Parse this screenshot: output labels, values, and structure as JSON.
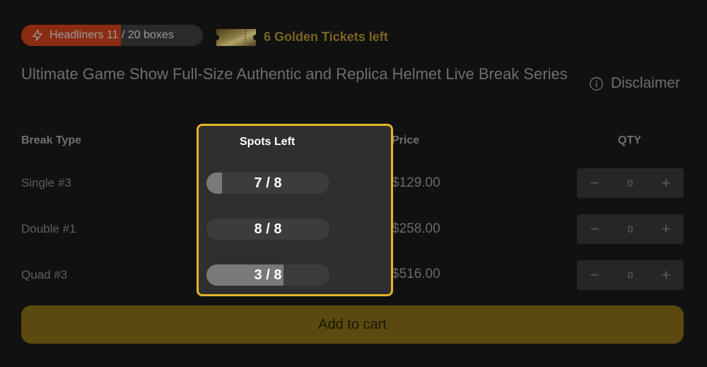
{
  "header": {
    "headliners_label": "Headliners 11 / 20 boxes",
    "headliners_progress": 0.55,
    "golden_tickets_label": "6 Golden Tickets left"
  },
  "title": "Ultimate Game Show Full-Size Authentic and Replica Helmet Live Break Series",
  "disclaimer_label": "Disclaimer",
  "table": {
    "columns": {
      "break_type": "Break Type",
      "spots_left": "Spots Left",
      "price": "Price",
      "qty": "QTY"
    },
    "rows": [
      {
        "break_type": "Single #3",
        "spots_text": "7 / 8",
        "spots_remaining": 7,
        "spots_total": 8,
        "price": "$129.00",
        "qty": "0"
      },
      {
        "break_type": "Double #1",
        "spots_text": "8 / 8",
        "spots_remaining": 8,
        "spots_total": 8,
        "price": "$258.00",
        "qty": "0"
      },
      {
        "break_type": "Quad #3",
        "spots_text": "3 / 8",
        "spots_remaining": 3,
        "spots_total": 8,
        "price": "$516.00",
        "qty": "0"
      }
    ]
  },
  "add_to_cart_label": "Add to cart",
  "icons": {
    "headliners": "lightning-bolt-icon",
    "tickets": "golden-ticket-icon",
    "disclaimer": "info-icon",
    "qty_minus": "minus-icon",
    "qty_plus": "plus-icon"
  },
  "colors": {
    "accent_yellow": "#e5b52a",
    "headliners_fill": "#8a2c12",
    "golden_text": "#7b6420"
  }
}
